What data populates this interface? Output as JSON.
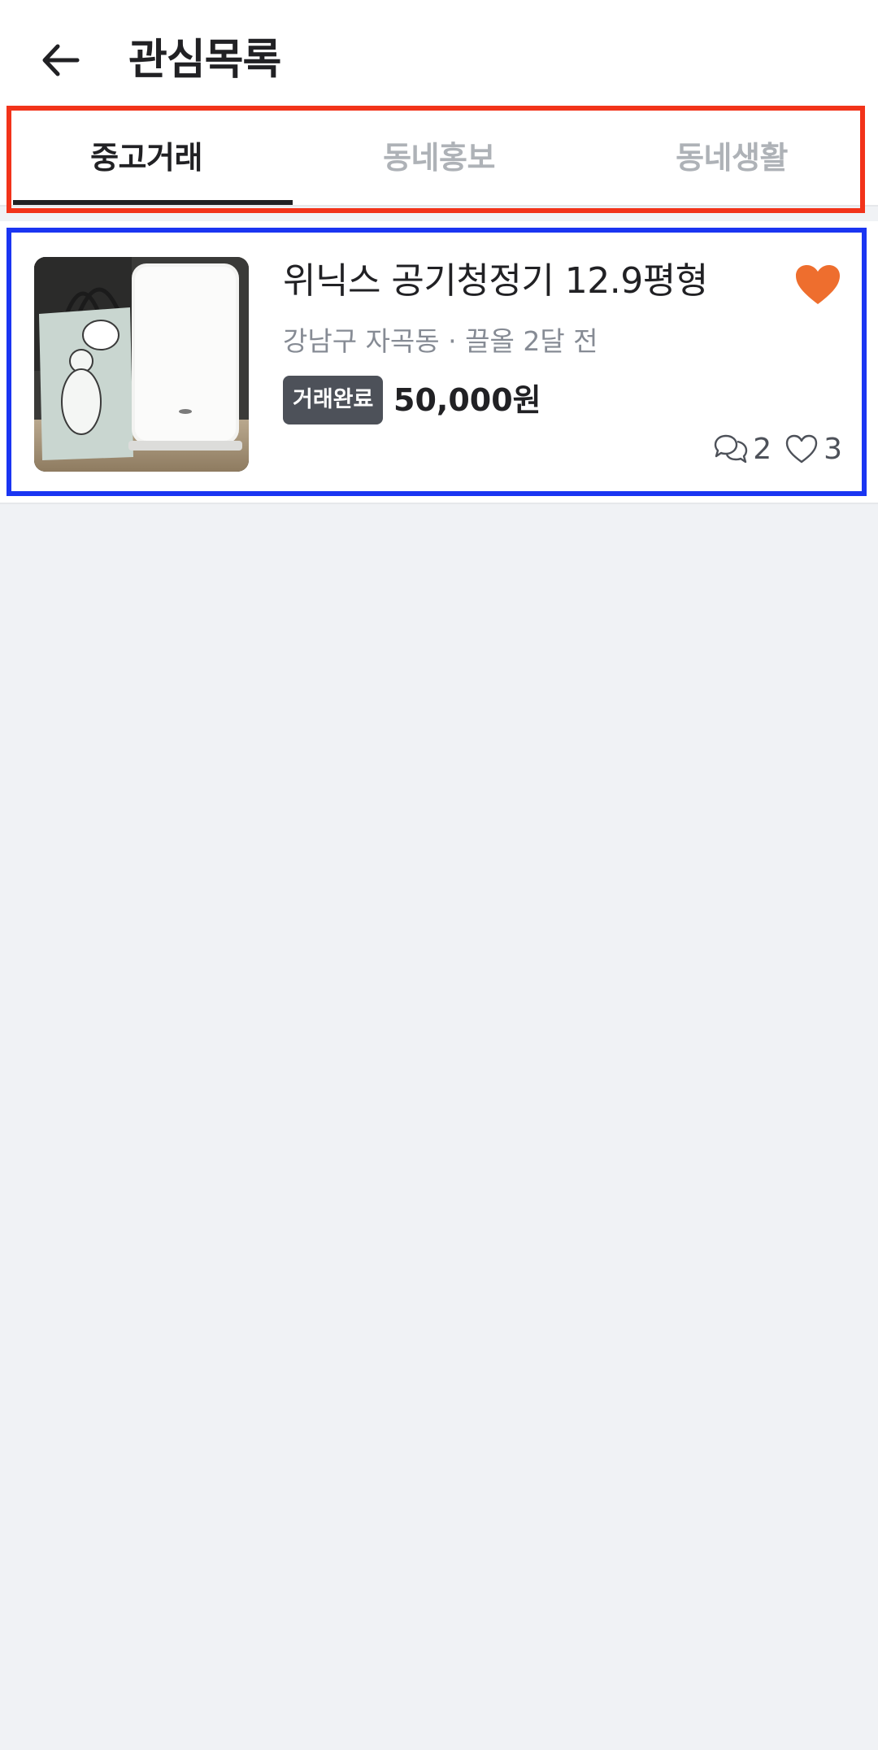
{
  "header": {
    "title": "관심목록",
    "back_icon": "arrow-left-icon"
  },
  "tabs": [
    {
      "label": "중고거래",
      "selected": true
    },
    {
      "label": "동네홍보",
      "selected": false
    },
    {
      "label": "동네생활",
      "selected": false
    }
  ],
  "colors": {
    "accent": "#ee6e2e",
    "badge_bg": "#4d5159",
    "muted_text": "#868b94",
    "inactive_tab": "#aeb2b7",
    "background": "#f0f2f5",
    "highlight_red": "#f2331a",
    "highlight_blue": "#1a35f2"
  },
  "items": [
    {
      "title": "위닉스 공기청정기 12.9평형",
      "meta": "강남구 자곡동 · 끌올 2달 전",
      "status": "거래완료",
      "price": "50,000원",
      "chat_count": "2",
      "like_count": "3",
      "favorited": true,
      "thumbnail_icon": "air-purifier-photo"
    }
  ]
}
